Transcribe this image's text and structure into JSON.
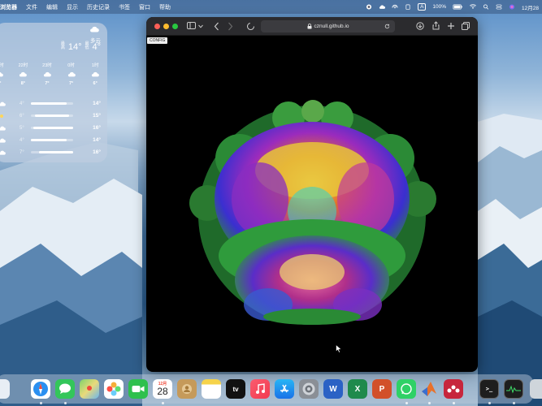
{
  "menubar": {
    "app_name": "浏览器",
    "items": [
      "文件",
      "编辑",
      "显示",
      "历史记录",
      "书签",
      "窗口",
      "帮助"
    ],
    "battery": "100%",
    "input_method": "A",
    "datetime": "12月28"
  },
  "weather": {
    "condition": "多云",
    "high": "14°",
    "low": "4°",
    "high_label": "最高",
    "low_label": "最低",
    "hours": [
      {
        "time": "21时",
        "temp": "9°"
      },
      {
        "time": "22时",
        "temp": "8°"
      },
      {
        "time": "23时",
        "temp": "7°"
      },
      {
        "time": "0时",
        "temp": "7°"
      },
      {
        "time": "1时",
        "temp": "6°"
      }
    ],
    "days": [
      {
        "low": "4°",
        "high": "14°",
        "fill_start": 0.0,
        "fill_end": 0.85
      },
      {
        "low": "6°",
        "high": "15°",
        "fill_start": 0.1,
        "fill_end": 0.9
      },
      {
        "low": "5°",
        "high": "16°",
        "fill_start": 0.05,
        "fill_end": 1.0
      },
      {
        "low": "4°",
        "high": "14°",
        "fill_start": 0.0,
        "fill_end": 0.85
      },
      {
        "low": "7°",
        "high": "16°",
        "fill_start": 0.2,
        "fill_end": 1.0
      }
    ]
  },
  "browser": {
    "url": "cznull.github.io",
    "config_label": "CONFIG"
  },
  "dock": {
    "calendar_month": "12月",
    "calendar_day": "28",
    "tv_label": "tv"
  },
  "colors": {
    "close": "#ff5f57",
    "minimize": "#febc2e",
    "zoom": "#28c840"
  }
}
